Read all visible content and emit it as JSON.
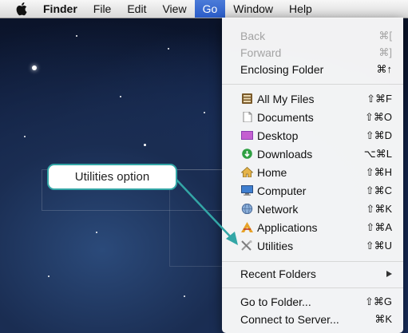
{
  "menubar": {
    "items": [
      {
        "label": "Finder"
      },
      {
        "label": "File"
      },
      {
        "label": "Edit"
      },
      {
        "label": "View"
      },
      {
        "label": "Go"
      },
      {
        "label": "Window"
      },
      {
        "label": "Help"
      }
    ],
    "active": "Go"
  },
  "go_menu": {
    "back": {
      "label": "Back",
      "shortcut": "⌘["
    },
    "forward": {
      "label": "Forward",
      "shortcut": "⌘]"
    },
    "enclosing": {
      "label": "Enclosing Folder",
      "shortcut": "⌘↑"
    },
    "places": [
      {
        "label": "All My Files",
        "shortcut": "⇧⌘F",
        "icon": "all-my-files-icon"
      },
      {
        "label": "Documents",
        "shortcut": "⇧⌘O",
        "icon": "documents-icon"
      },
      {
        "label": "Desktop",
        "shortcut": "⇧⌘D",
        "icon": "desktop-icon"
      },
      {
        "label": "Downloads",
        "shortcut": "⌥⌘L",
        "icon": "downloads-icon"
      },
      {
        "label": "Home",
        "shortcut": "⇧⌘H",
        "icon": "home-icon"
      },
      {
        "label": "Computer",
        "shortcut": "⇧⌘C",
        "icon": "computer-icon"
      },
      {
        "label": "Network",
        "shortcut": "⇧⌘K",
        "icon": "network-icon"
      },
      {
        "label": "Applications",
        "shortcut": "⇧⌘A",
        "icon": "applications-icon"
      },
      {
        "label": "Utilities",
        "shortcut": "⇧⌘U",
        "icon": "utilities-icon"
      }
    ],
    "recent_folders": {
      "label": "Recent Folders"
    },
    "go_to_folder": {
      "label": "Go to Folder...",
      "shortcut": "⇧⌘G"
    },
    "connect": {
      "label": "Connect to Server...",
      "shortcut": "⌘K"
    }
  },
  "callout": {
    "label": "Utilities option"
  },
  "colors": {
    "accent": "#2a5cc8",
    "callout_border": "#33a6a6"
  }
}
